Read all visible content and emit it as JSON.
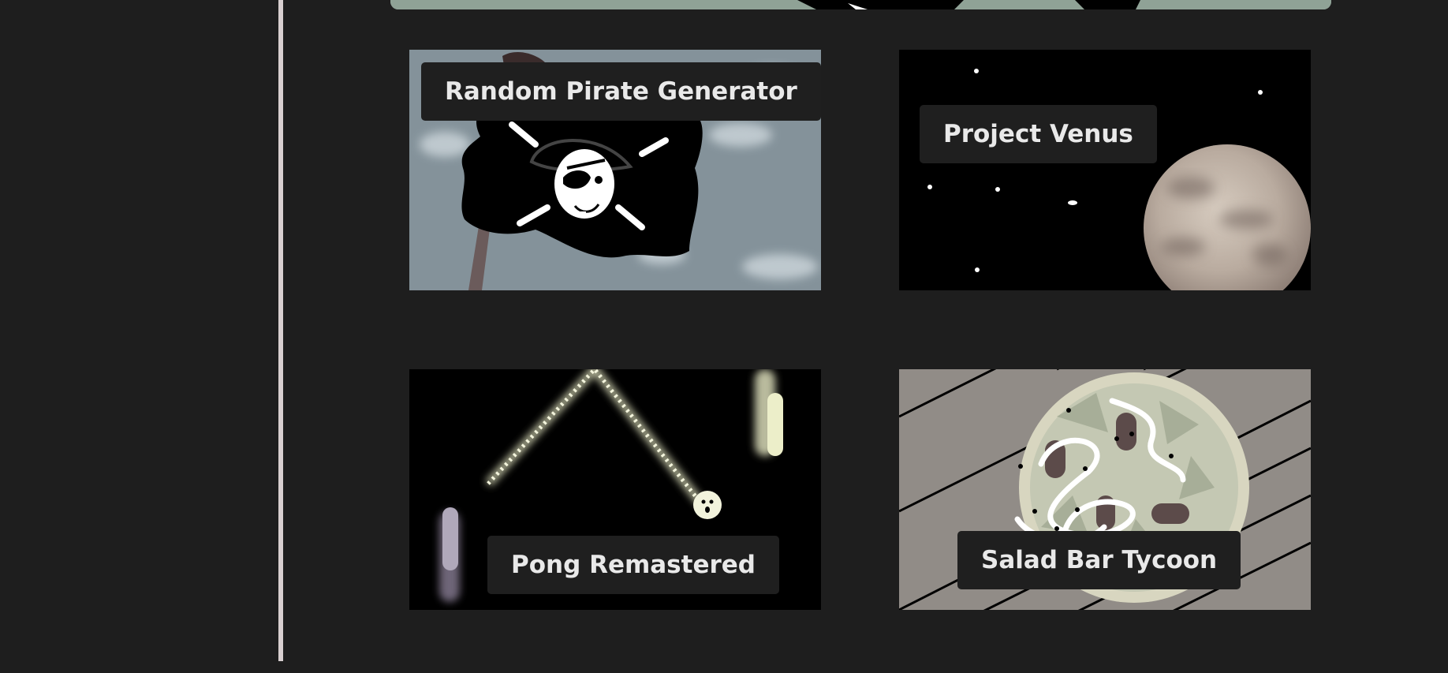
{
  "games": [
    {
      "title": "Random Pirate Generator",
      "thumbnail": "pirate-flag"
    },
    {
      "title": "Project Venus",
      "thumbnail": "planet-venus"
    },
    {
      "title": "Pong Remastered",
      "thumbnail": "pong-glow"
    },
    {
      "title": "Salad Bar Tycoon",
      "thumbnail": "salad-bowl"
    }
  ],
  "colors": {
    "background": "#1e1e1e",
    "label_bg": "#1f1f1f",
    "label_text": "#e9e9e9",
    "divider": "#d8cfd0",
    "banner": "#8fa296"
  }
}
